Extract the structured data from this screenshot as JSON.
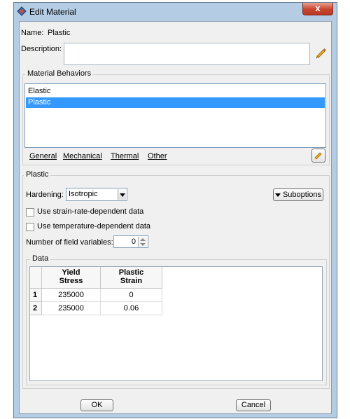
{
  "window": {
    "title": "Edit Material",
    "close_glyph": "x"
  },
  "name": {
    "label": "Name:",
    "value": "Plastic"
  },
  "description": {
    "label": "Description:",
    "value": ""
  },
  "behaviors": {
    "group_title": "Material Behaviors",
    "items": [
      {
        "label": "Elastic",
        "selected": false
      },
      {
        "label": "Plastic",
        "selected": true
      }
    ]
  },
  "menu": {
    "items": [
      "General",
      "Mechanical",
      "Thermal",
      "Other"
    ]
  },
  "plastic": {
    "section_title": "Plastic",
    "hardening_label": "Hardening:",
    "hardening_value": "Isotropic",
    "suboptions_label": "Suboptions",
    "strain_rate_label": "Use strain-rate-dependent data",
    "strain_rate_checked": false,
    "temperature_label": "Use temperature-dependent data",
    "temperature_checked": false,
    "field_vars_label": "Number of field variables:",
    "field_vars_value": "0"
  },
  "data_table": {
    "group_title": "Data",
    "columns": [
      {
        "line1": "Yield",
        "line2": "Stress"
      },
      {
        "line1": "Plastic",
        "line2": "Strain"
      }
    ],
    "rows": [
      {
        "index": "1",
        "cells": [
          "235000",
          "0"
        ]
      },
      {
        "index": "2",
        "cells": [
          "235000",
          "0.06"
        ]
      }
    ]
  },
  "buttons": {
    "ok": "OK",
    "cancel": "Cancel"
  },
  "icons": {
    "edit": "pencil-icon",
    "app": "abaqus-icon",
    "tool": "edit-tool-icon"
  },
  "colors": {
    "selection": "#3399ff",
    "frame": "#b5cde4",
    "background": "#f0f0f0"
  }
}
